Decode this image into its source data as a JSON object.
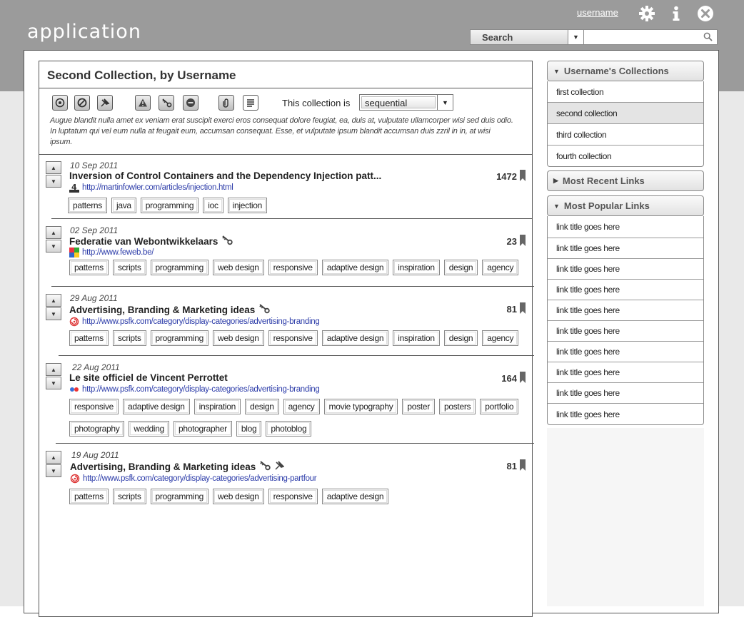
{
  "header": {
    "app_title": "application",
    "username": "username",
    "search_scope": "Search",
    "search_placeholder": ""
  },
  "icons": [
    "gear-icon",
    "info-icon",
    "close-icon",
    "search-icon",
    "bookmark-icon"
  ],
  "collection": {
    "title": "Second Collection, by Username",
    "sequence_label": "This collection is",
    "sequence_value": "sequential",
    "description": "Augue blandit nulla amet ex veniam erat suscipit exerci eros consequat dolore feugiat, ea, duis at, vulputate ullamcorper wisi sed duis odio. In luptatum qui vel eum nulla at feugait eum, accumsan consequat. Esse, et vulputate ipsum blandit accumsan duis zzril in in, at wisi ipsum.",
    "toolbar": [
      "view-icon",
      "block-icon",
      "pin-icon",
      "warning-icon",
      "key-icon",
      "minus-icon",
      "attach-icon",
      "notes-icon"
    ]
  },
  "links": [
    {
      "date": "10 Sep 2011",
      "title": "Inversion of Control Containers and the Dependency Injection patt...",
      "url": "http://martinfowler.com/articles/injection.html",
      "count": "1472",
      "tags": [
        "patterns",
        "java",
        "programming",
        "ioc",
        "injection"
      ]
    },
    {
      "date": "02 Sep 2011",
      "title": "Federatie van Webontwikkelaars",
      "url": "http://www.feweb.be/",
      "count": "23",
      "tags": [
        "patterns",
        "scripts",
        "programming",
        "web design",
        "responsive",
        "adaptive design",
        "inspiration",
        "design",
        "agency"
      ]
    },
    {
      "date": "29 Aug 2011",
      "title": "Advertising, Branding & Marketing ideas",
      "url": "http://www.psfk.com/category/display-categories/advertising-branding",
      "count": "81",
      "tags": [
        "patterns",
        "scripts",
        "programming",
        "web design",
        "responsive",
        "adaptive design",
        "inspiration",
        "design",
        "agency"
      ]
    },
    {
      "date": "22 Aug 2011",
      "title": "Le site officiel de Vincent Perrottet",
      "url": "http://www.psfk.com/category/display-categories/advertising-branding",
      "count": "164",
      "tags": [
        "responsive",
        "adaptive design",
        "inspiration",
        "design",
        "agency",
        "movie typography",
        "poster",
        "posters",
        "portfolio",
        "photography",
        "wedding",
        "photographer",
        "blog",
        "photoblog"
      ]
    },
    {
      "date": "19 Aug 2011",
      "title": "Advertising, Branding & Marketing ideas",
      "url": "http://www.psfk.com/category/display-categories/advertising-partfour",
      "count": "81",
      "tags": [
        "patterns",
        "scripts",
        "programming",
        "web design",
        "responsive",
        "adaptive design"
      ]
    }
  ],
  "sidebar": {
    "collections_header": "Username's Collections",
    "collections": [
      "first collection",
      "second collection",
      "third collection",
      "fourth collection"
    ],
    "selected_collection": "second collection",
    "recent_header": "Most Recent Links",
    "popular_header": "Most Popular Links",
    "popular_links": [
      "link title goes here",
      "link title goes here",
      "link title goes here",
      "link title goes here",
      "link title goes here",
      "link title goes here",
      "link title goes here",
      "link title goes here",
      "link title goes here",
      "link title goes here"
    ]
  },
  "colors": {
    "header_gray": "#9b9b9b",
    "link_blue": "#2a3aa8",
    "selected_row": "#e4e4e4"
  }
}
